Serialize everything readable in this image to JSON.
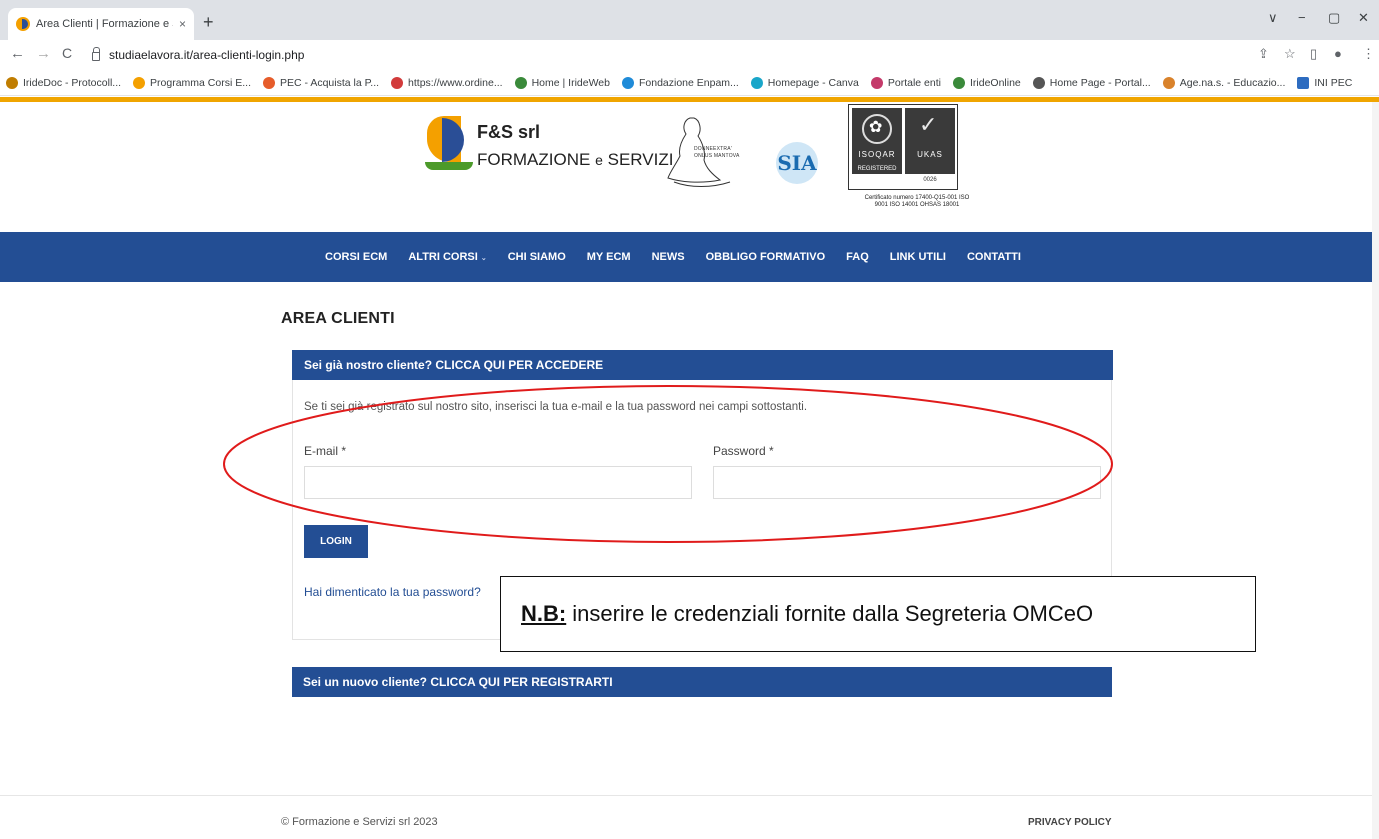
{
  "browser": {
    "tab_title": "Area Clienti | Formazione e Servi",
    "tab_close": "×",
    "new_tab": "+",
    "url": "studiaelavora.it/area-clienti-login.php",
    "window_controls": [
      "∨",
      "−",
      "▢",
      "✕"
    ],
    "nav": {
      "back": "←",
      "forward": "→",
      "reload": "C"
    },
    "toolbar_icons": [
      "⇪",
      "☆",
      "▯",
      "●",
      "⋮"
    ],
    "bookmarks": [
      {
        "label": "IrideDoc - Protocoll...",
        "color": "#c07d00"
      },
      {
        "label": "Programma Corsi E...",
        "color": "#f4a000"
      },
      {
        "label": "PEC - Acquista la P...",
        "color": "#e65c2a"
      },
      {
        "label": "https://www.ordine...",
        "color": "#d23b3b"
      },
      {
        "label": "Home | IrideWeb",
        "color": "#3a8a3a"
      },
      {
        "label": "Fondazione Enpam...",
        "color": "#1f8bd8"
      },
      {
        "label": "Homepage - Canva",
        "color": "#19a6c9"
      },
      {
        "label": "Portale enti",
        "color": "#c43a6a"
      },
      {
        "label": "IrideOnline",
        "color": "#3a8a3a"
      },
      {
        "label": "Home Page - Portal...",
        "color": "#555555"
      },
      {
        "label": "Age.na.s. - Educazio...",
        "color": "#d9822b"
      },
      {
        "label": "INI PEC",
        "color": "#2d6cc0"
      }
    ]
  },
  "header": {
    "logo_brand": "F&S srl",
    "logo_brand_amp": "&",
    "logo_sub_1": "FORMAZIONE",
    "logo_sub_e": "e",
    "logo_sub_2": "SERVIZI",
    "donne_line1": "DONNEEXTRA'",
    "donne_line2": "ONLUS MANTOVA",
    "sia_logo": "SIA",
    "cert_left_label": "ISOQAR",
    "cert_left_sub": "REGISTERED",
    "cert_right_label": "UKAS",
    "cert_number": "0026",
    "cert_text": "Certificato numero 17400-Q15-001 ISO 9001 ISO 14001 OHSAS 18001"
  },
  "nav": {
    "items": [
      {
        "label": "CORSI ECM"
      },
      {
        "label": "ALTRI CORSI",
        "dropdown": "⌄"
      },
      {
        "label": "CHI SIAMO"
      },
      {
        "label": "MY ECM"
      },
      {
        "label": "NEWS"
      },
      {
        "label": "OBBLIGO FORMATIVO"
      },
      {
        "label": "FAQ"
      },
      {
        "label": "LINK UTILI"
      },
      {
        "label": "CONTATTI"
      }
    ]
  },
  "main": {
    "title": "AREA CLIENTI",
    "login_panel": {
      "heading": "Sei già nostro cliente? CLICCA QUI PER ACCEDERE",
      "description": "Se ti sei già registrato sul nostro sito, inserisci la tua e-mail e la tua password nei campi sottostanti.",
      "email_label": "E-mail *",
      "email_value": "",
      "password_label": "Password *",
      "password_value": "",
      "login_button": "LOGIN",
      "forgot_link": "Hai dimenticato la tua password?"
    },
    "annotation": {
      "label": "N.B:",
      "text": "inserire le credenziali fornite dalla Segreteria OMCeO",
      "ellipse_color": "#e01b1b"
    },
    "register_panel": {
      "heading": "Sei un nuovo cliente? CLICCA QUI PER REGISTRARTI"
    }
  },
  "footer": {
    "copyright": "© Formazione e Servizi srl 2023",
    "privacy": "PRIVACY POLICY"
  },
  "colors": {
    "brand_blue": "#234e94",
    "accent_orange": "#f0a500"
  }
}
